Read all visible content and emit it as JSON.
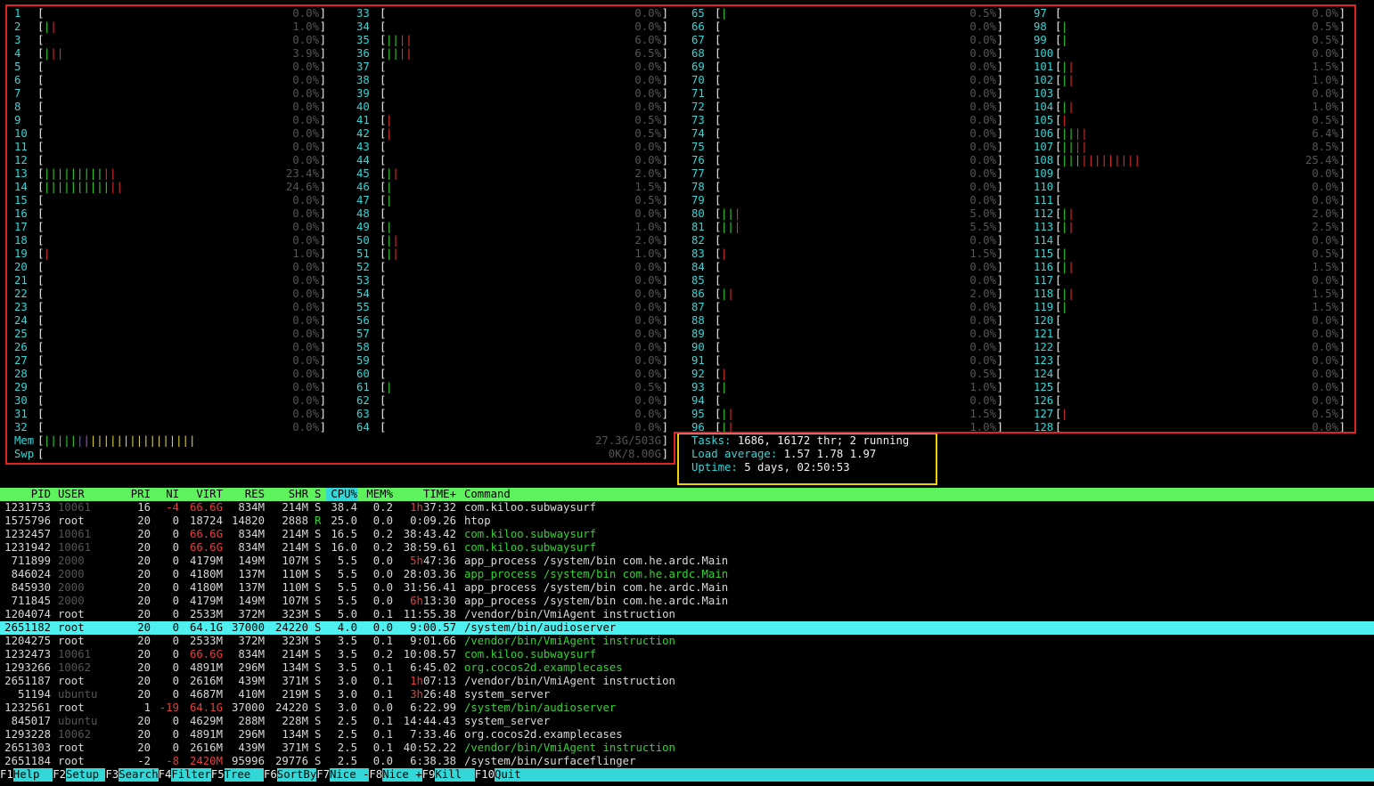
{
  "cpus": [
    [
      "1",
      "0.0%",
      []
    ],
    [
      "2",
      "1.0%",
      [
        "g",
        "r"
      ]
    ],
    [
      "3",
      "0.0%",
      []
    ],
    [
      "4",
      "3.9%",
      [
        "g",
        "r",
        "r"
      ]
    ],
    [
      "5",
      "0.0%",
      []
    ],
    [
      "6",
      "0.0%",
      []
    ],
    [
      "7",
      "0.0%",
      []
    ],
    [
      "8",
      "0.0%",
      []
    ],
    [
      "9",
      "0.0%",
      []
    ],
    [
      "10",
      "0.0%",
      []
    ],
    [
      "11",
      "0.0%",
      []
    ],
    [
      "12",
      "0.0%",
      []
    ],
    [
      "13",
      "23.4%",
      [
        "g",
        "g",
        "g",
        "g",
        "g",
        "g",
        "g",
        "g",
        "g",
        "r",
        "r"
      ]
    ],
    [
      "14",
      "24.6%",
      [
        "g",
        "g",
        "g",
        "g",
        "g",
        "g",
        "g",
        "g",
        "g",
        "g",
        "r",
        "r"
      ]
    ],
    [
      "15",
      "0.0%",
      []
    ],
    [
      "16",
      "0.0%",
      []
    ],
    [
      "17",
      "0.0%",
      []
    ],
    [
      "18",
      "0.0%",
      []
    ],
    [
      "19",
      "1.0%",
      [
        "r"
      ]
    ],
    [
      "20",
      "0.0%",
      []
    ],
    [
      "21",
      "0.0%",
      []
    ],
    [
      "22",
      "0.0%",
      []
    ],
    [
      "23",
      "0.0%",
      []
    ],
    [
      "24",
      "0.0%",
      []
    ],
    [
      "25",
      "0.0%",
      []
    ],
    [
      "26",
      "0.0%",
      []
    ],
    [
      "27",
      "0.0%",
      []
    ],
    [
      "28",
      "0.0%",
      []
    ],
    [
      "29",
      "0.0%",
      []
    ],
    [
      "30",
      "0.0%",
      []
    ],
    [
      "31",
      "0.0%",
      []
    ],
    [
      "32",
      "0.0%",
      []
    ],
    [
      "33",
      "0.0%",
      []
    ],
    [
      "34",
      "0.0%",
      []
    ],
    [
      "35",
      "6.0%",
      [
        "g",
        "g",
        "r",
        "r"
      ]
    ],
    [
      "36",
      "6.5%",
      [
        "g",
        "g",
        "r",
        "r"
      ]
    ],
    [
      "37",
      "0.0%",
      []
    ],
    [
      "38",
      "0.0%",
      []
    ],
    [
      "39",
      "0.0%",
      []
    ],
    [
      "40",
      "0.0%",
      []
    ],
    [
      "41",
      "0.5%",
      [
        "r"
      ]
    ],
    [
      "42",
      "0.5%",
      [
        "r"
      ]
    ],
    [
      "43",
      "0.0%",
      []
    ],
    [
      "44",
      "0.0%",
      []
    ],
    [
      "45",
      "2.0%",
      [
        "g",
        "r"
      ]
    ],
    [
      "46",
      "1.5%",
      [
        "g"
      ]
    ],
    [
      "47",
      "0.5%",
      [
        "g"
      ]
    ],
    [
      "48",
      "0.0%",
      []
    ],
    [
      "49",
      "1.0%",
      [
        "g"
      ]
    ],
    [
      "50",
      "2.0%",
      [
        "g",
        "r"
      ]
    ],
    [
      "51",
      "1.0%",
      [
        "g",
        "r"
      ]
    ],
    [
      "52",
      "0.0%",
      []
    ],
    [
      "53",
      "0.0%",
      []
    ],
    [
      "54",
      "0.0%",
      []
    ],
    [
      "55",
      "0.0%",
      []
    ],
    [
      "56",
      "0.0%",
      []
    ],
    [
      "57",
      "0.0%",
      []
    ],
    [
      "58",
      "0.0%",
      []
    ],
    [
      "59",
      "0.0%",
      []
    ],
    [
      "60",
      "0.0%",
      []
    ],
    [
      "61",
      "0.5%",
      [
        "g"
      ]
    ],
    [
      "62",
      "0.0%",
      []
    ],
    [
      "63",
      "0.0%",
      []
    ],
    [
      "64",
      "0.0%",
      []
    ],
    [
      "65",
      "0.5%",
      [
        "g"
      ]
    ],
    [
      "66",
      "0.0%",
      []
    ],
    [
      "67",
      "0.0%",
      []
    ],
    [
      "68",
      "0.0%",
      []
    ],
    [
      "69",
      "0.0%",
      []
    ],
    [
      "70",
      "0.0%",
      []
    ],
    [
      "71",
      "0.0%",
      []
    ],
    [
      "72",
      "0.0%",
      []
    ],
    [
      "73",
      "0.0%",
      []
    ],
    [
      "74",
      "0.0%",
      []
    ],
    [
      "75",
      "0.0%",
      []
    ],
    [
      "76",
      "0.0%",
      []
    ],
    [
      "77",
      "0.0%",
      []
    ],
    [
      "78",
      "0.0%",
      []
    ],
    [
      "79",
      "0.0%",
      []
    ],
    [
      "80",
      "5.0%",
      [
        "g",
        "g",
        "r"
      ]
    ],
    [
      "81",
      "5.5%",
      [
        "g",
        "g",
        "r"
      ]
    ],
    [
      "82",
      "0.0%",
      []
    ],
    [
      "83",
      "1.5%",
      [
        "r"
      ]
    ],
    [
      "84",
      "0.0%",
      []
    ],
    [
      "85",
      "0.0%",
      []
    ],
    [
      "86",
      "2.0%",
      [
        "g",
        "r"
      ]
    ],
    [
      "87",
      "0.0%",
      []
    ],
    [
      "88",
      "0.0%",
      []
    ],
    [
      "89",
      "0.0%",
      []
    ],
    [
      "90",
      "0.0%",
      []
    ],
    [
      "91",
      "0.0%",
      []
    ],
    [
      "92",
      "0.5%",
      [
        "r"
      ]
    ],
    [
      "93",
      "1.0%",
      [
        "g"
      ]
    ],
    [
      "94",
      "0.0%",
      []
    ],
    [
      "95",
      "1.5%",
      [
        "g",
        "r"
      ]
    ],
    [
      "96",
      "1.0%",
      [
        "g",
        "r"
      ]
    ],
    [
      "97",
      "0.0%",
      []
    ],
    [
      "98",
      "0.5%",
      [
        "g"
      ]
    ],
    [
      "99",
      "0.5%",
      [
        "g"
      ]
    ],
    [
      "100",
      "0.0%",
      []
    ],
    [
      "101",
      "1.5%",
      [
        "g",
        "r"
      ]
    ],
    [
      "102",
      "1.0%",
      [
        "g",
        "r"
      ]
    ],
    [
      "103",
      "0.0%",
      []
    ],
    [
      "104",
      "1.0%",
      [
        "g",
        "r"
      ]
    ],
    [
      "105",
      "0.5%",
      [
        "r"
      ]
    ],
    [
      "106",
      "6.4%",
      [
        "g",
        "g",
        "r",
        "r"
      ]
    ],
    [
      "107",
      "8.5%",
      [
        "g",
        "g",
        "r",
        "r"
      ]
    ],
    [
      "108",
      "25.4%",
      [
        "g",
        "g",
        "g",
        "r",
        "r",
        "r",
        "r",
        "r",
        "r",
        "r",
        "r",
        "r"
      ]
    ],
    [
      "109",
      "0.0%",
      []
    ],
    [
      "110",
      "0.0%",
      []
    ],
    [
      "111",
      "0.0%",
      []
    ],
    [
      "112",
      "2.0%",
      [
        "g",
        "r"
      ]
    ],
    [
      "113",
      "2.5%",
      [
        "g",
        "r"
      ]
    ],
    [
      "114",
      "0.0%",
      []
    ],
    [
      "115",
      "0.5%",
      [
        "g"
      ]
    ],
    [
      "116",
      "1.5%",
      [
        "g",
        "r"
      ]
    ],
    [
      "117",
      "0.0%",
      []
    ],
    [
      "118",
      "1.5%",
      [
        "g",
        "r"
      ]
    ],
    [
      "119",
      "1.5%",
      [
        "g"
      ]
    ],
    [
      "120",
      "0.0%",
      []
    ],
    [
      "121",
      "0.0%",
      []
    ],
    [
      "122",
      "0.0%",
      []
    ],
    [
      "123",
      "0.0%",
      []
    ],
    [
      "124",
      "0.0%",
      []
    ],
    [
      "125",
      "0.0%",
      []
    ],
    [
      "126",
      "0.0%",
      []
    ],
    [
      "127",
      "0.5%",
      [
        "r"
      ]
    ],
    [
      "128",
      "0.0%",
      []
    ]
  ],
  "memory": {
    "mem_label": "Mem",
    "mem_value": "27.3G/503G",
    "mem_bar": [
      "g",
      "g",
      "g",
      "g",
      "g",
      "b",
      "m",
      "y",
      "y",
      "y",
      "y",
      "y",
      "y",
      "y",
      "y",
      "y",
      "y",
      "y",
      "y",
      "y",
      "y",
      "y",
      "y"
    ],
    "swp_label": "Swp",
    "swp_value": "0K/8.00G"
  },
  "info": {
    "tasks_label": "Tasks:",
    "tasks_value": "1686, 16172 thr; 2 running",
    "load_label": "Load average:",
    "load_value": "1.57 1.78 1.97",
    "uptime_label": "Uptime:",
    "uptime_value": "5 days, 02:50:53"
  },
  "columns": [
    "PID",
    "USER",
    "PRI",
    "NI",
    "VIRT",
    "RES",
    "SHR",
    "S",
    "CPU%",
    "MEM%",
    "TIME+",
    "Command"
  ],
  "processes": [
    {
      "pid": "1231753",
      "user": "10061",
      "pri": "16",
      "ni": "-4",
      "virt": "66.6G",
      "res": "834M",
      "shr": "214M",
      "s": "S",
      "cpu": "38.4",
      "mem": "0.2",
      "time": "1h37:32",
      "cmd": "com.kiloo.subwaysurf",
      "ud": 1,
      "nr": 1,
      "vr": 1,
      "tr": "1h",
      "cg": 0
    },
    {
      "pid": "1575796",
      "user": "root",
      "pri": "20",
      "ni": "0",
      "virt": "18724",
      "res": "14820",
      "shr": "2888",
      "s": "R",
      "cpu": "25.0",
      "mem": "0.0",
      "time": "0:09.26",
      "cmd": "htop",
      "ud": 0,
      "nr": 0,
      "vr": 0,
      "tr": "",
      "cg": 0,
      "sg": 1
    },
    {
      "pid": "1232457",
      "user": "10061",
      "pri": "20",
      "ni": "0",
      "virt": "66.6G",
      "res": "834M",
      "shr": "214M",
      "s": "S",
      "cpu": "16.5",
      "mem": "0.2",
      "time": "38:43.42",
      "cmd": "com.kiloo.subwaysurf",
      "ud": 1,
      "nr": 0,
      "vr": 1,
      "tr": "",
      "cg": 1
    },
    {
      "pid": "1231942",
      "user": "10061",
      "pri": "20",
      "ni": "0",
      "virt": "66.6G",
      "res": "834M",
      "shr": "214M",
      "s": "S",
      "cpu": "16.0",
      "mem": "0.2",
      "time": "38:59.61",
      "cmd": "com.kiloo.subwaysurf",
      "ud": 1,
      "nr": 0,
      "vr": 1,
      "tr": "",
      "cg": 1
    },
    {
      "pid": "711899",
      "user": "2000",
      "pri": "20",
      "ni": "0",
      "virt": "4179M",
      "res": "149M",
      "shr": "107M",
      "s": "S",
      "cpu": "5.5",
      "mem": "0.0",
      "time": "5h47:36",
      "cmd": "app_process /system/bin com.he.ardc.Main",
      "ud": 1,
      "nr": 0,
      "vr": 0,
      "tr": "5h",
      "cg": 0
    },
    {
      "pid": "846024",
      "user": "2000",
      "pri": "20",
      "ni": "0",
      "virt": "4180M",
      "res": "137M",
      "shr": "110M",
      "s": "S",
      "cpu": "5.5",
      "mem": "0.0",
      "time": "28:03.36",
      "cmd": "app_process /system/bin com.he.ardc.Main",
      "ud": 1,
      "nr": 0,
      "vr": 0,
      "tr": "",
      "cg": 1
    },
    {
      "pid": "845930",
      "user": "2000",
      "pri": "20",
      "ni": "0",
      "virt": "4180M",
      "res": "137M",
      "shr": "110M",
      "s": "S",
      "cpu": "5.5",
      "mem": "0.0",
      "time": "31:56.41",
      "cmd": "app_process /system/bin com.he.ardc.Main",
      "ud": 1,
      "nr": 0,
      "vr": 0,
      "tr": "",
      "cg": 0
    },
    {
      "pid": "711845",
      "user": "2000",
      "pri": "20",
      "ni": "0",
      "virt": "4179M",
      "res": "149M",
      "shr": "107M",
      "s": "S",
      "cpu": "5.5",
      "mem": "0.0",
      "time": "6h13:30",
      "cmd": "app_process /system/bin com.he.ardc.Main",
      "ud": 1,
      "nr": 0,
      "vr": 0,
      "tr": "6h",
      "cg": 0
    },
    {
      "pid": "1204074",
      "user": "root",
      "pri": "20",
      "ni": "0",
      "virt": "2533M",
      "res": "372M",
      "shr": "323M",
      "s": "S",
      "cpu": "5.0",
      "mem": "0.1",
      "time": "11:55.38",
      "cmd": "/vendor/bin/VmiAgent instruction",
      "ud": 0,
      "nr": 0,
      "vr": 0,
      "tr": "",
      "cg": 0
    },
    {
      "pid": "2651182",
      "user": "root",
      "pri": "20",
      "ni": "0",
      "virt": "64.1G",
      "res": "37000",
      "shr": "24220",
      "s": "S",
      "cpu": "4.0",
      "mem": "0.0",
      "time": "9:00.57",
      "cmd": "/system/bin/audioserver",
      "ud": 0,
      "nr": 0,
      "vr": 0,
      "tr": "",
      "cg": 0,
      "sel": 1
    },
    {
      "pid": "1204275",
      "user": "root",
      "pri": "20",
      "ni": "0",
      "virt": "2533M",
      "res": "372M",
      "shr": "323M",
      "s": "S",
      "cpu": "3.5",
      "mem": "0.1",
      "time": "9:01.66",
      "cmd": "/vendor/bin/VmiAgent instruction",
      "ud": 0,
      "nr": 0,
      "vr": 0,
      "tr": "",
      "cg": 1
    },
    {
      "pid": "1232473",
      "user": "10061",
      "pri": "20",
      "ni": "0",
      "virt": "66.6G",
      "res": "834M",
      "shr": "214M",
      "s": "S",
      "cpu": "3.5",
      "mem": "0.2",
      "time": "10:08.57",
      "cmd": "com.kiloo.subwaysurf",
      "ud": 1,
      "nr": 0,
      "vr": 1,
      "tr": "",
      "cg": 1
    },
    {
      "pid": "1293266",
      "user": "10062",
      "pri": "20",
      "ni": "0",
      "virt": "4891M",
      "res": "296M",
      "shr": "134M",
      "s": "S",
      "cpu": "3.5",
      "mem": "0.1",
      "time": "6:45.02",
      "cmd": "org.cocos2d.examplecases",
      "ud": 1,
      "nr": 0,
      "vr": 0,
      "tr": "",
      "cg": 1
    },
    {
      "pid": "2651187",
      "user": "root",
      "pri": "20",
      "ni": "0",
      "virt": "2616M",
      "res": "439M",
      "shr": "371M",
      "s": "S",
      "cpu": "3.0",
      "mem": "0.1",
      "time": "1h07:13",
      "cmd": "/vendor/bin/VmiAgent instruction",
      "ud": 0,
      "nr": 0,
      "vr": 0,
      "tr": "1h",
      "cg": 0
    },
    {
      "pid": "51194",
      "user": "ubuntu",
      "pri": "20",
      "ni": "0",
      "virt": "4687M",
      "res": "410M",
      "shr": "219M",
      "s": "S",
      "cpu": "3.0",
      "mem": "0.1",
      "time": "3h26:48",
      "cmd": "system_server",
      "ud": 1,
      "nr": 0,
      "vr": 0,
      "tr": "3h",
      "cg": 0
    },
    {
      "pid": "1232561",
      "user": "root",
      "pri": "1",
      "ni": "-19",
      "virt": "64.1G",
      "res": "37000",
      "shr": "24220",
      "s": "S",
      "cpu": "3.0",
      "mem": "0.0",
      "time": "6:22.99",
      "cmd": "/system/bin/audioserver",
      "ud": 0,
      "nr": 1,
      "vr": 1,
      "tr": "",
      "cg": 1
    },
    {
      "pid": "845017",
      "user": "ubuntu",
      "pri": "20",
      "ni": "0",
      "virt": "4629M",
      "res": "288M",
      "shr": "228M",
      "s": "S",
      "cpu": "2.5",
      "mem": "0.1",
      "time": "14:44.43",
      "cmd": "system_server",
      "ud": 1,
      "nr": 0,
      "vr": 0,
      "tr": "",
      "cg": 0
    },
    {
      "pid": "1293228",
      "user": "10062",
      "pri": "20",
      "ni": "0",
      "virt": "4891M",
      "res": "296M",
      "shr": "134M",
      "s": "S",
      "cpu": "2.5",
      "mem": "0.1",
      "time": "7:33.46",
      "cmd": "org.cocos2d.examplecases",
      "ud": 1,
      "nr": 0,
      "vr": 0,
      "tr": "",
      "cg": 0
    },
    {
      "pid": "2651303",
      "user": "root",
      "pri": "20",
      "ni": "0",
      "virt": "2616M",
      "res": "439M",
      "shr": "371M",
      "s": "S",
      "cpu": "2.5",
      "mem": "0.1",
      "time": "40:52.22",
      "cmd": "/vendor/bin/VmiAgent instruction",
      "ud": 0,
      "nr": 0,
      "vr": 0,
      "tr": "",
      "cg": 1
    },
    {
      "pid": "2651184",
      "user": "root",
      "pri": "-2",
      "ni": "-8",
      "virt": "2420M",
      "res": "95996",
      "shr": "29776",
      "s": "S",
      "cpu": "2.5",
      "mem": "0.0",
      "time": "6:38.38",
      "cmd": "/system/bin/surfaceflinger",
      "ud": 0,
      "nr": 1,
      "vr": 1,
      "tr": "",
      "cg": 0
    }
  ],
  "footer": [
    [
      "F1",
      "Help"
    ],
    [
      "F2",
      "Setup"
    ],
    [
      "F3",
      "Search"
    ],
    [
      "F4",
      "Filter"
    ],
    [
      "F5",
      "Tree"
    ],
    [
      "F6",
      "SortBy"
    ],
    [
      "F7",
      "Nice -"
    ],
    [
      "F8",
      "Nice +"
    ],
    [
      "F9",
      "Kill"
    ],
    [
      "F10",
      "Quit"
    ]
  ]
}
